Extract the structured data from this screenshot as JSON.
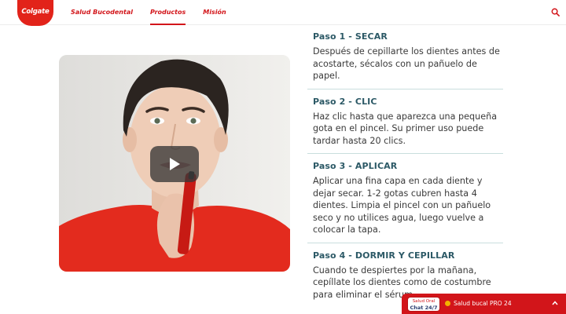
{
  "header": {
    "logo_text": "Colgate",
    "nav": [
      {
        "label": "Salud Bucodental",
        "active": false
      },
      {
        "label": "Productos",
        "active": true
      },
      {
        "label": "Misión",
        "active": false
      }
    ],
    "brand_color": "#d2151a",
    "search_icon": "search-icon"
  },
  "video": {
    "play_icon": "play-icon"
  },
  "steps": [
    {
      "title": "Paso 1 - SECAR",
      "text": "Después de cepillarte los dientes antes de acostarte, sécalos con un pañuelo de papel."
    },
    {
      "title": "Paso 2 - CLIC",
      "text": "Haz clic hasta que aparezca una pequeña gota en el pincel. Su primer uso puede tardar hasta 20 clics."
    },
    {
      "title": "Paso 3 - APLICAR",
      "text": "Aplicar una fina capa en cada diente y dejar secar. 1-2 gotas cubren hasta 4 dientes. Limpia el pincel con un pañuelo seco y no utilices agua, luego vuelve a colocar la tapa."
    },
    {
      "title": "Paso 4 - DORMIR Y CEPILLAR",
      "text": "Cuando te despiertes por la mañana, cepíllate los dientes como de costumbre para eliminar el sérum."
    }
  ],
  "chat": {
    "badge_line1": "Salud Oral",
    "badge_line2": "Chat 24/7",
    "label": "Salud bucal PRO 24",
    "status_color": "#f2b100"
  }
}
